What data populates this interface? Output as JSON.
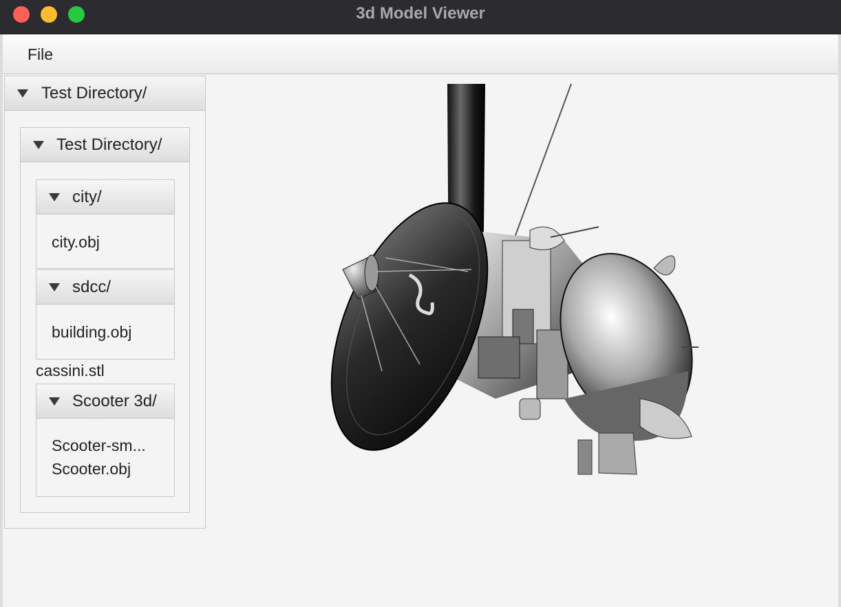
{
  "window": {
    "title": "3d Model Viewer"
  },
  "menubar": {
    "items": [
      {
        "label": "File"
      }
    ]
  },
  "tree": {
    "root": {
      "label": "Test Directory/",
      "child": {
        "label": "Test Directory/",
        "folders": [
          {
            "label": "city/",
            "files": [
              "city.obj"
            ]
          },
          {
            "label": "sdcc/",
            "files": [
              "building.obj"
            ]
          }
        ],
        "loose_file": "cassini.stl",
        "folder_last": {
          "label": "Scooter 3d/",
          "files": [
            "Scooter-sm...",
            "Scooter.obj"
          ]
        }
      }
    }
  },
  "viewport": {
    "model_icon": "cassini-spacecraft-3d-model"
  }
}
